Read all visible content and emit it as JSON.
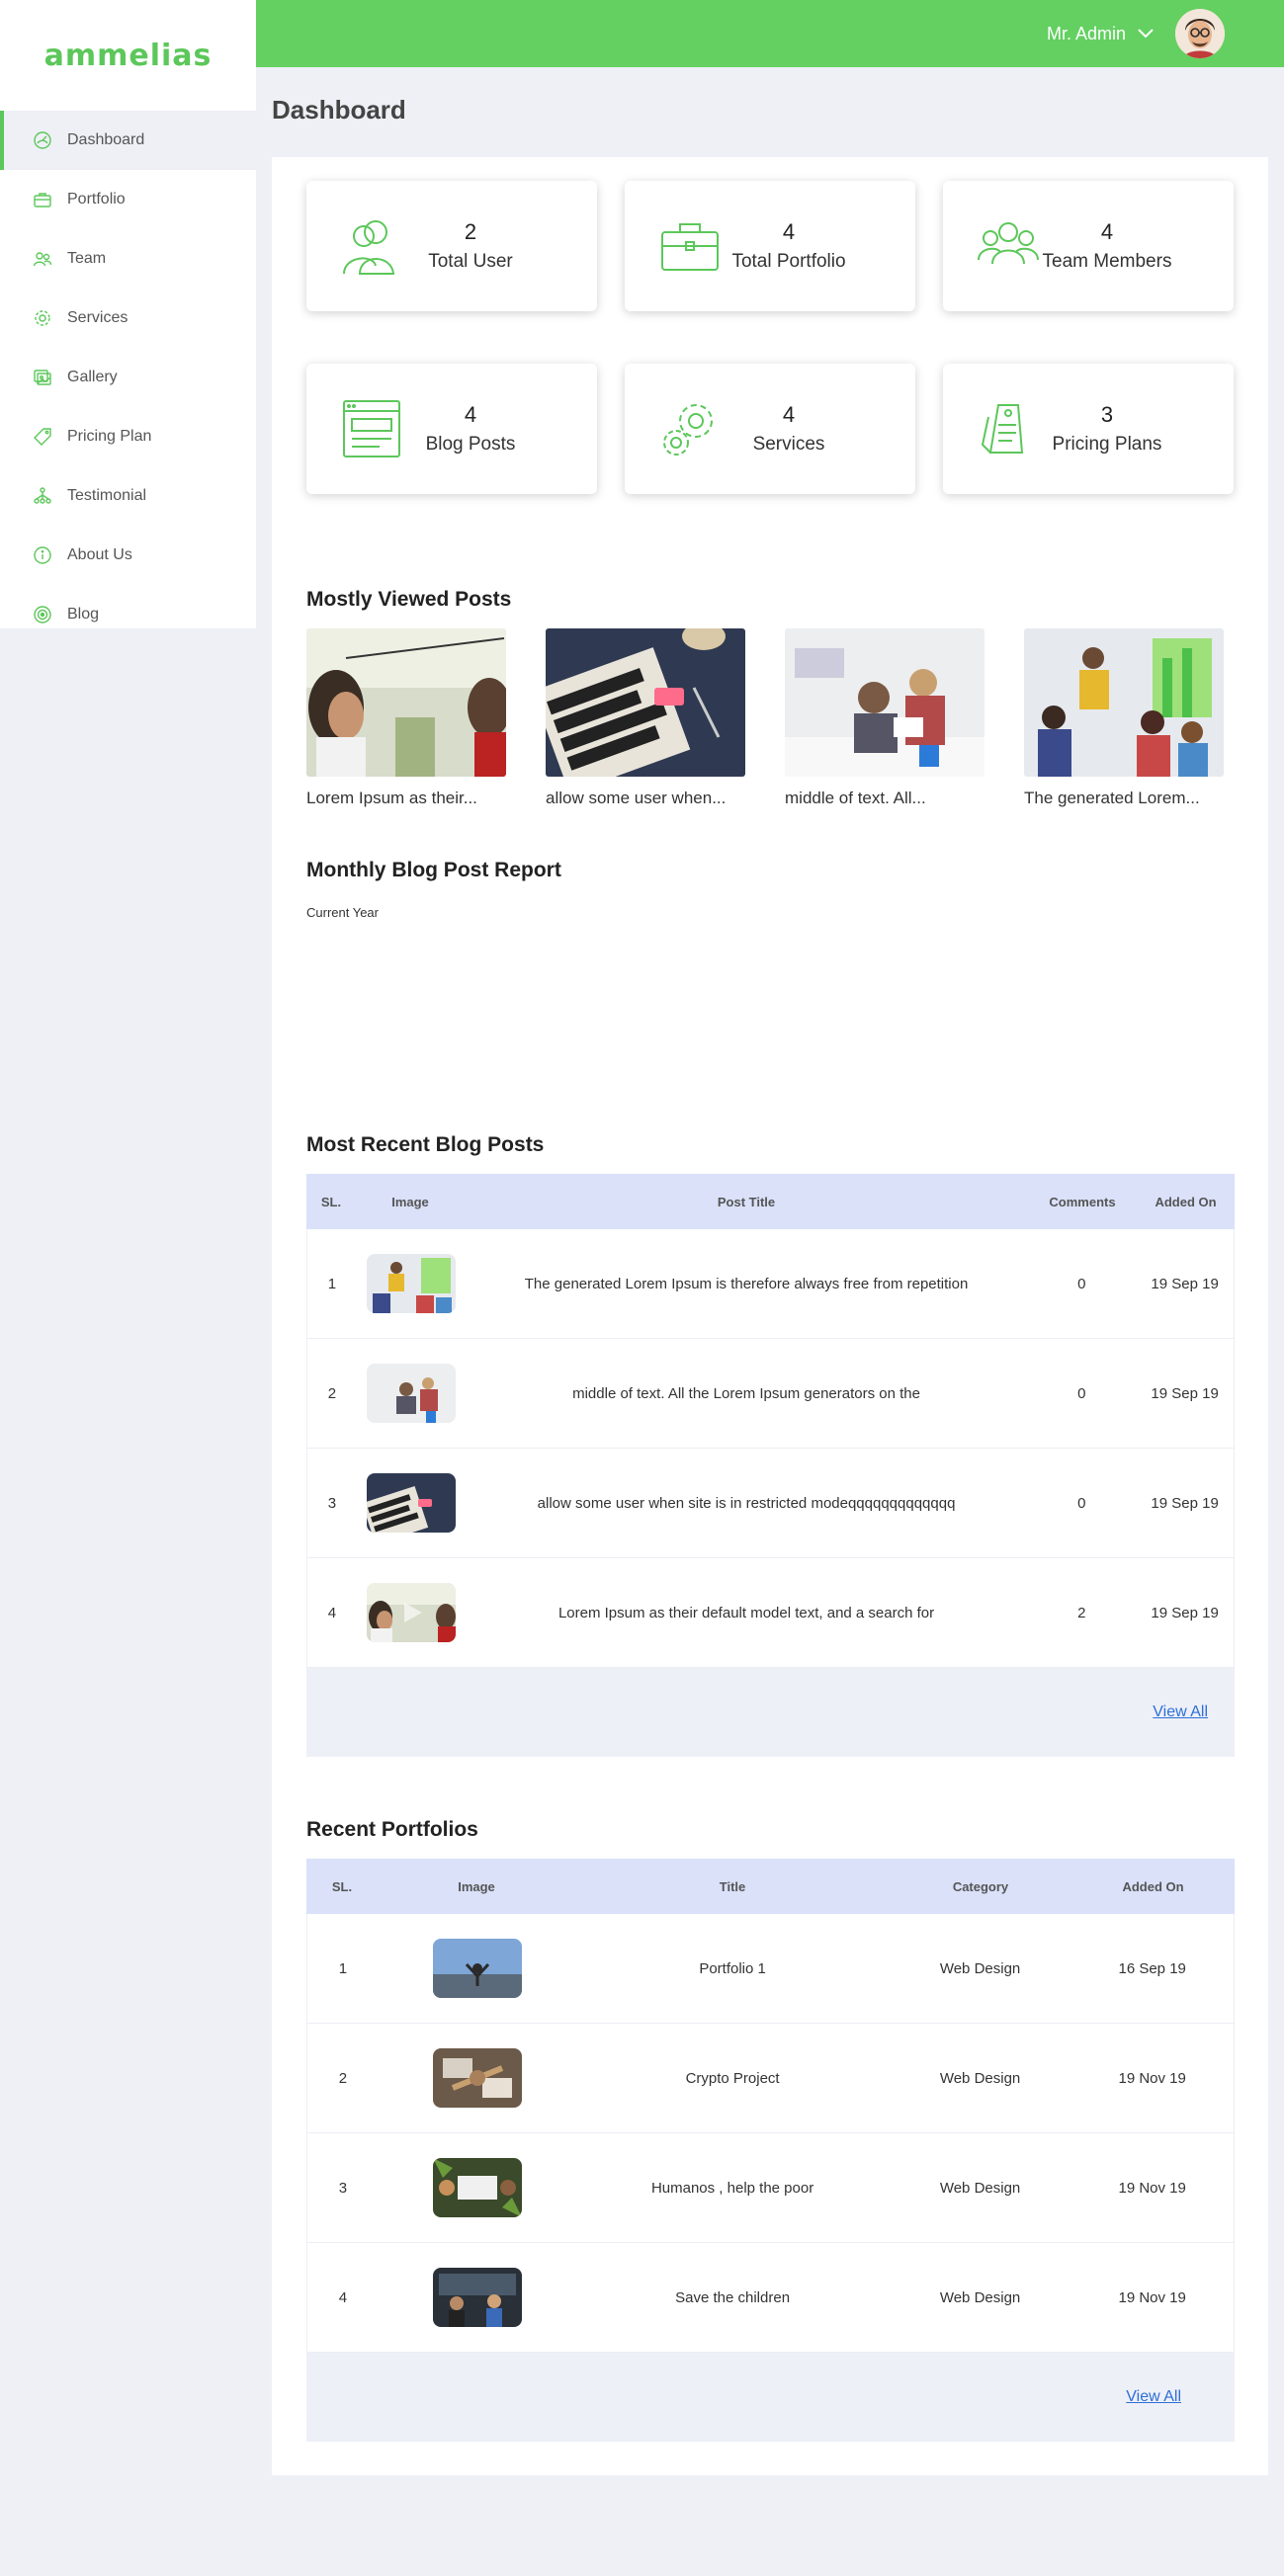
{
  "brand": "ammelias",
  "colors": {
    "accent": "#63d061",
    "table_header": "#dae1f9",
    "link": "#2d6fd6"
  },
  "sidebar": {
    "items": [
      {
        "label": "Dashboard",
        "icon": "dashboard-icon"
      },
      {
        "label": "Portfolio",
        "icon": "briefcase-icon"
      },
      {
        "label": "Team",
        "icon": "team-icon"
      },
      {
        "label": "Services",
        "icon": "gear-icon"
      },
      {
        "label": "Gallery",
        "icon": "gallery-icon"
      },
      {
        "label": "Pricing Plan",
        "icon": "tag-icon"
      },
      {
        "label": "Testimonial",
        "icon": "network-icon"
      },
      {
        "label": "About Us",
        "icon": "info-icon"
      },
      {
        "label": "Blog",
        "icon": "blog-icon"
      }
    ]
  },
  "header": {
    "user_name": "Mr. Admin"
  },
  "page_title": "Dashboard",
  "stats": [
    {
      "value": "2",
      "label": "Total User",
      "icon": "users-icon"
    },
    {
      "value": "4",
      "label": "Total Portfolio",
      "icon": "briefcase-icon"
    },
    {
      "value": "4",
      "label": "Team Members",
      "icon": "team-icon"
    },
    {
      "value": "4",
      "label": "Blog Posts",
      "icon": "blog-window-icon"
    },
    {
      "value": "4",
      "label": "Services",
      "icon": "gears-icon"
    },
    {
      "value": "3",
      "label": "Pricing Plans",
      "icon": "price-tag-icon"
    }
  ],
  "mostly_viewed": {
    "title": "Mostly Viewed Posts",
    "posts": [
      {
        "caption": "Lorem Ipsum as their..."
      },
      {
        "caption": "allow some user when..."
      },
      {
        "caption": "middle of text. All..."
      },
      {
        "caption": "The generated Lorem..."
      }
    ]
  },
  "monthly_report": {
    "title": "Monthly Blog Post Report",
    "subtitle": "Current Year"
  },
  "recent_posts": {
    "title": "Most Recent Blog Posts",
    "columns": [
      "SL.",
      "Image",
      "Post Title",
      "Comments",
      "Added On"
    ],
    "rows": [
      {
        "sl": "1",
        "title": "The generated Lorem Ipsum is therefore always free from repetition",
        "comments": "0",
        "added": "19 Sep 19"
      },
      {
        "sl": "2",
        "title": "middle of text. All the Lorem Ipsum generators on the",
        "comments": "0",
        "added": "19 Sep 19"
      },
      {
        "sl": "3",
        "title": "allow some user when site is in restricted modeqqqqqqqqqqqqq",
        "comments": "0",
        "added": "19 Sep 19"
      },
      {
        "sl": "4",
        "title": "Lorem Ipsum as their default model text, and a search for",
        "comments": "2",
        "added": "19 Sep 19"
      }
    ],
    "view_all": "View All"
  },
  "recent_portfolios": {
    "title": "Recent Portfolios",
    "columns": [
      "SL.",
      "Image",
      "Title",
      "Category",
      "Added On"
    ],
    "rows": [
      {
        "sl": "1",
        "title": "Portfolio 1",
        "category": "Web Design",
        "added": "16 Sep 19"
      },
      {
        "sl": "2",
        "title": "Crypto Project",
        "category": "Web Design",
        "added": "19 Nov 19"
      },
      {
        "sl": "3",
        "title": "Humanos , help the poor",
        "category": "Web Design",
        "added": "19 Nov 19"
      },
      {
        "sl": "4",
        "title": "Save the children",
        "category": "Web Design",
        "added": "19 Nov 19"
      }
    ],
    "view_all": "View All"
  }
}
